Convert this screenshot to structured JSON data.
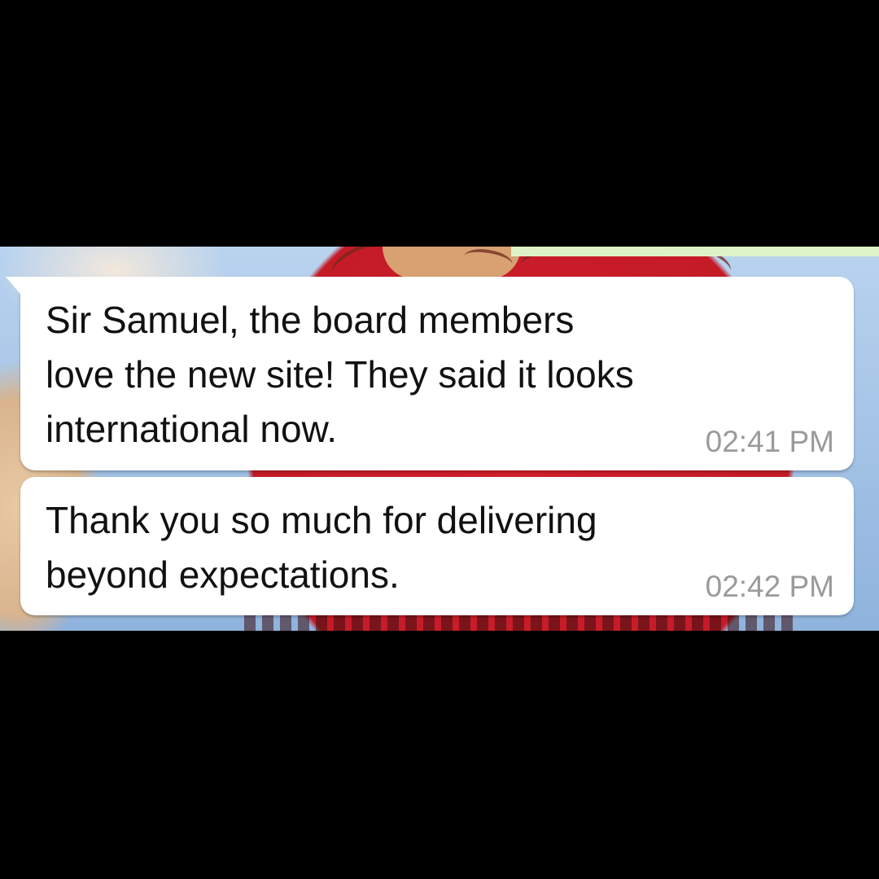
{
  "colors": {
    "background": "#000000",
    "bubble": "#ffffff",
    "message_text": "#111111",
    "timestamp": "#9a9a9a"
  },
  "messages": [
    {
      "text": "Sir Samuel, the board members\nlove the new site! They said it looks\ninternational now.",
      "time": "02:41 PM"
    },
    {
      "text": "Thank you so much for delivering\nbeyond expectations.",
      "time": "02:42 PM"
    }
  ]
}
